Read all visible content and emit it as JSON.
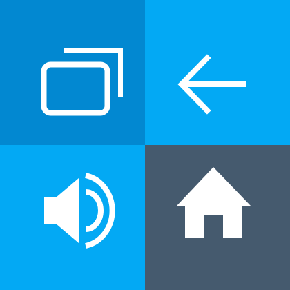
{
  "tiles": [
    {
      "icon": "recent-apps-icon",
      "color": "#0288D1"
    },
    {
      "icon": "back-arrow-icon",
      "color": "#03A9F4"
    },
    {
      "icon": "volume-icon",
      "color": "#03A9F4"
    },
    {
      "icon": "home-icon",
      "color": "#455A6E"
    }
  ]
}
